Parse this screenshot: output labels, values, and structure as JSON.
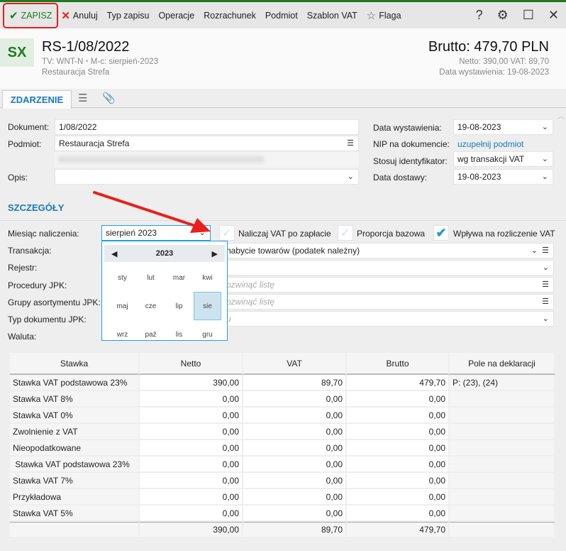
{
  "toolbar": {
    "save": "ZAPISZ",
    "cancel": "Anuluj",
    "items": [
      "Typ zapisu",
      "Operacje",
      "Rozrachunek",
      "Podmiot",
      "Szablon VAT"
    ],
    "flag": "Flaga",
    "help": "?"
  },
  "header": {
    "badge": "SX",
    "title": "RS-1/08/2022",
    "line1a": "TV: WNT-N",
    "sep": "•",
    "line1b": "M-c: sierpień-2023",
    "line2": "Restauracja Strefa",
    "brutto": "Brutto: 479,70 PLN",
    "netto_vat": "Netto: 390,00 VAT: 89,70",
    "date": "Data wystawienia: 19-08-2023"
  },
  "tabs": {
    "main": "ZDARZENIE"
  },
  "form": {
    "dokument_label": "Dokument:",
    "dokument": "1/08/2022",
    "podmiot_label": "Podmiot:",
    "podmiot": "Restauracja Strefa",
    "opis_label": "Opis:",
    "opis": "",
    "data_wyst_label": "Data wystawienia:",
    "data_wyst": "19-08-2023",
    "nip_label": "NIP na dokumencie:",
    "nip_link": "uzupełnij podmiot",
    "ident_label": "Stosuj identyfikator:",
    "ident": "wg transakcji VAT",
    "data_dost_label": "Data dostawy:",
    "data_dost": "19-08-2023"
  },
  "details": {
    "title": "SZCZEGÓŁY",
    "miesiac_label": "Miesiąc naliczenia:",
    "miesiac": "sierpień 2023",
    "cb1": "Naliczaj VAT po zapłacie",
    "cb1_checked": false,
    "cb2": "Proporcja bazowa",
    "cb2_checked": false,
    "cb3": "Wpływa na rozliczenie VAT",
    "cb3_checked": true,
    "transakcja_label": "Transakcja:",
    "transakcja": "nabycie towarów (podatek należny)",
    "rejestr_label": "Rejestr:",
    "rejestr": "",
    "procedury_label": "Procedury JPK:",
    "procedury_ph": "ozwinąć listę",
    "grupy_label": "Grupy asortymentu JPK:",
    "grupy_ph": "ozwinąć listę",
    "typ_label": "Typ dokumentu JPK:",
    "typ_ph": "u",
    "waluta_label": "Waluta:"
  },
  "calendar": {
    "year": "2023",
    "months": [
      "sty",
      "lut",
      "mar",
      "kwi",
      "maj",
      "cze",
      "lip",
      "sie",
      "wrz",
      "paź",
      "lis",
      "gru"
    ],
    "selected": 7
  },
  "table": {
    "headers": [
      "Stawka",
      "Netto",
      "VAT",
      "Brutto",
      "Pole na deklaracji"
    ],
    "rows": [
      [
        "Stawka VAT podstawowa 23%",
        "390,00",
        "89,70",
        "479,70",
        "P: (23), (24)"
      ],
      [
        "Stawka VAT 8%",
        "0,00",
        "0,00",
        "0,00",
        ""
      ],
      [
        "Stawka VAT 0%",
        "0,00",
        "0,00",
        "0,00",
        ""
      ],
      [
        "Zwolnienie z VAT",
        "0,00",
        "0,00",
        "0,00",
        ""
      ],
      [
        "Nieopodatkowane",
        "0,00",
        "0,00",
        "0,00",
        ""
      ],
      [
        " Stawka VAT podstawowa 23%",
        "0,00",
        "0,00",
        "0,00",
        ""
      ],
      [
        "Stawka VAT 7%",
        "0,00",
        "0,00",
        "0,00",
        ""
      ],
      [
        "Przykładowa",
        "0,00",
        "0,00",
        "0,00",
        ""
      ],
      [
        "Stawka VAT 5%",
        "0,00",
        "0,00",
        "0,00",
        ""
      ]
    ],
    "total": [
      "",
      "390,00",
      "89,70",
      "479,70",
      ""
    ]
  },
  "colors": {
    "accent": "#1a7ab5",
    "save": "#1e7a1e",
    "highlight": "#e02020"
  }
}
